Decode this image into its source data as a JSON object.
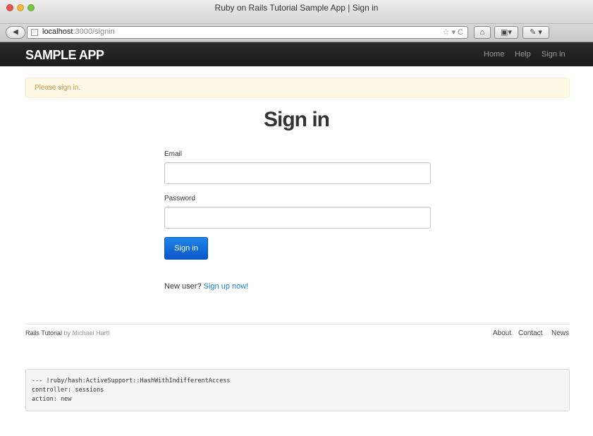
{
  "window": {
    "title": "Ruby on Rails Tutorial Sample App | Sign in"
  },
  "toolbar": {
    "back_glyph": "◀",
    "url_host": "localhost",
    "url_path": ":3000/signin",
    "url_actions": "☆ ▾ C",
    "home_glyph": "⌂",
    "bookmarks_glyph": "▣▾",
    "extra_glyph": "✎ ▾"
  },
  "navbar": {
    "logo": "SAMPLE APP",
    "links": [
      "Home",
      "Help",
      "Sign in"
    ]
  },
  "flash": {
    "message": "Please sign in."
  },
  "form": {
    "heading": "Sign in",
    "email_label": "Email",
    "email_value": "",
    "password_label": "Password",
    "password_value": "",
    "submit_label": "Sign in",
    "new_user_text": "New user?",
    "signup_link": "Sign up now!"
  },
  "footer": {
    "brand": "Rails Tutorial",
    "by_text": "by Michael Hartl",
    "links": [
      "About",
      "Contact",
      "News"
    ]
  },
  "debug": {
    "lines": [
      "--- !ruby/hash:ActiveSupport::HashWithIndifferentAccess",
      "controller: sessions",
      "action: new"
    ]
  },
  "colors": {
    "navbar_bg": "#1b1b1b",
    "flash_bg": "#fcf8e3",
    "flash_text": "#c09853",
    "primary_button": "#0b56c9",
    "link": "#1a7fd8"
  }
}
